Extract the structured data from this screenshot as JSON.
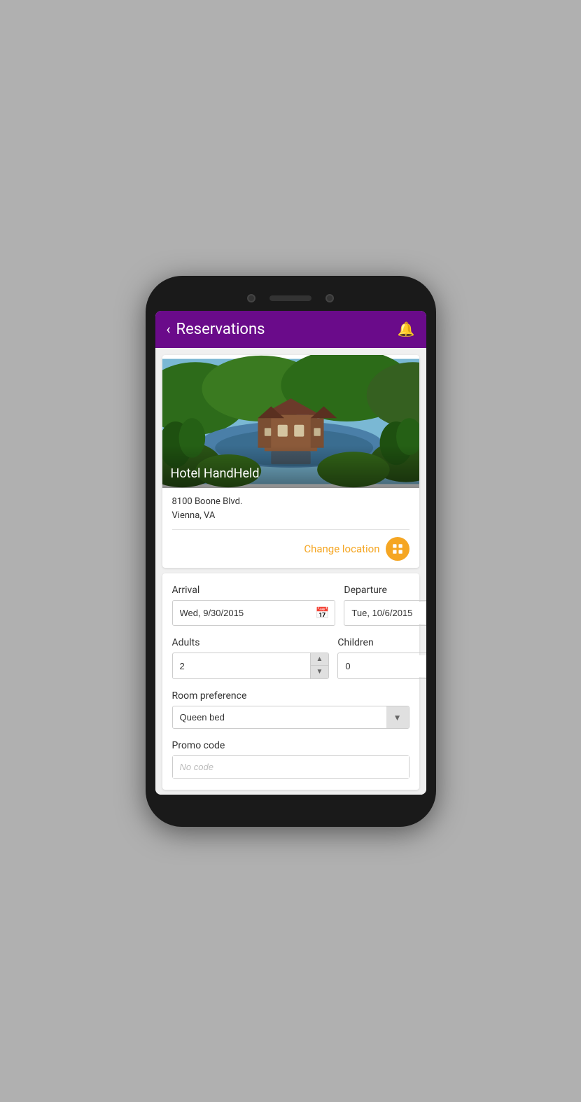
{
  "header": {
    "title": "Reservations",
    "back_label": "‹",
    "bell_label": "🔔"
  },
  "hotel": {
    "name": "Hotel HandHeld",
    "address_line1": "8100 Boone Blvd.",
    "address_line2": "Vienna, VA",
    "change_location_label": "Change location"
  },
  "form": {
    "arrival_label": "Arrival",
    "arrival_value": "Wed, 9/30/2015",
    "departure_label": "Departure",
    "departure_value": "Tue, 10/6/2015",
    "adults_label": "Adults",
    "adults_value": "2",
    "children_label": "Children",
    "children_value": "0",
    "room_preference_label": "Room preference",
    "room_preference_value": "Queen bed",
    "promo_code_label": "Promo code",
    "promo_code_placeholder": "No code"
  }
}
